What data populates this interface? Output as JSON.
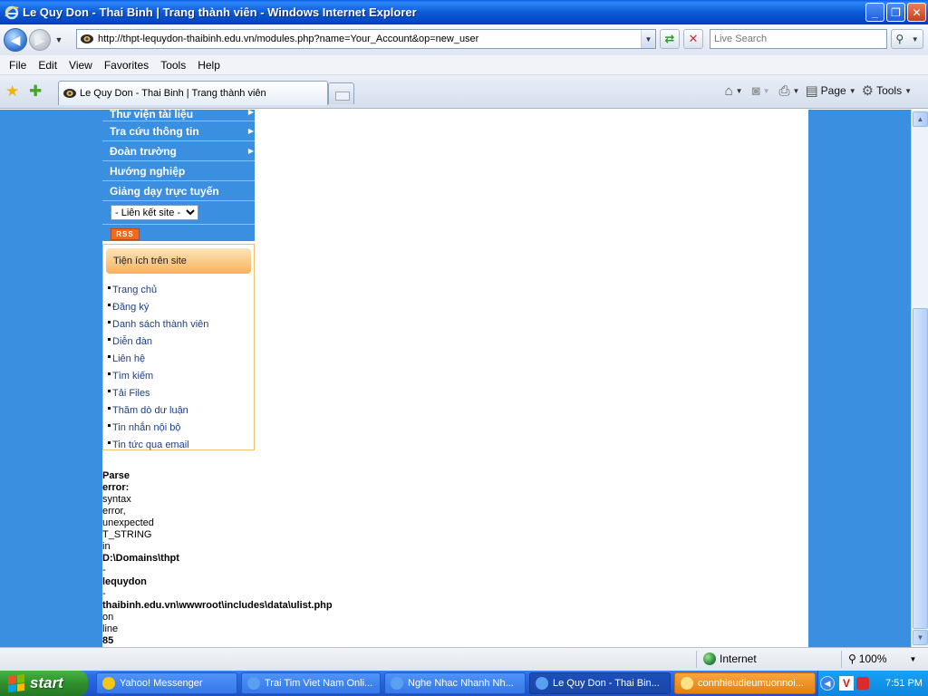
{
  "window": {
    "title": "Le Quy Don - Thai Binh | Trang thành viên - Windows Internet Explorer",
    "btn_min": "_",
    "btn_max": "❐",
    "btn_close": "✕"
  },
  "address": {
    "url": "http://thpt-lequydon-thaibinh.edu.vn/modules.php?name=Your_Account&op=new_user",
    "search_placeholder": "Live Search"
  },
  "menubar": {
    "items": [
      "File",
      "Edit",
      "View",
      "Favorites",
      "Tools",
      "Help"
    ]
  },
  "tabs": {
    "active_label": "Le Quy Don - Thai Binh | Trang thành viên"
  },
  "commandbar": {
    "page": "Page",
    "tools": "Tools"
  },
  "sidebar": {
    "nav": [
      {
        "label": "Thư viện tài liệu",
        "arrow": "▶"
      },
      {
        "label": "Tra cứu thông tin",
        "arrow": "▶"
      },
      {
        "label": "Đoàn trường",
        "arrow": "▶"
      },
      {
        "label": "Hướng nghiệp",
        "arrow": ""
      },
      {
        "label": "Giảng dạy trực tuyến",
        "arrow": ""
      }
    ],
    "link_select": "- Liên kết site -",
    "rss": "RSS"
  },
  "utilities": {
    "heading": "Tiện ích trên site",
    "items": [
      "Trang chủ",
      "Đăng ký",
      "Danh sách thành viên",
      "Diễn đàn",
      "Liên hệ",
      "Tìm kiếm",
      "Tải Files",
      "Thăm dò dư luận",
      "Tin nhắn nội bộ",
      "Tin tức qua email"
    ]
  },
  "error": {
    "lines": [
      {
        "text": "Parse",
        "bold": true
      },
      {
        "text": "error:",
        "bold": true
      },
      {
        "text": "syntax",
        "bold": false
      },
      {
        "text": "error,",
        "bold": false
      },
      {
        "text": "unexpected",
        "bold": false
      },
      {
        "text": "T_STRING",
        "bold": false
      },
      {
        "text": "in",
        "bold": false
      },
      {
        "text": "D:\\Domains\\thpt",
        "bold": true
      },
      {
        "text": "-",
        "bold": false
      },
      {
        "text": "lequydon",
        "bold": true
      },
      {
        "text": "-",
        "bold": false
      },
      {
        "text": "thaibinh.edu.vn\\wwwroot\\includes\\data\\ulist.php",
        "bold": true
      },
      {
        "text": "on",
        "bold": false
      },
      {
        "text": "line",
        "bold": false
      },
      {
        "text": "85",
        "bold": true
      }
    ]
  },
  "statusbar": {
    "zone": "Internet",
    "zoom": "100%"
  },
  "taskbar": {
    "start": "start",
    "items": [
      {
        "label": "Yahoo! Messenger",
        "icon_color": "#f5c518",
        "state": "normal"
      },
      {
        "label": "Trai Tim Viet Nam Onli...",
        "icon_color": "#5aa0f0",
        "state": "normal"
      },
      {
        "label": "Nghe Nhac Nhanh Nh...",
        "icon_color": "#5aa0f0",
        "state": "normal"
      },
      {
        "label": "Le Quy Don - Thai Bin...",
        "icon_color": "#5aa0f0",
        "state": "active"
      },
      {
        "label": "connhieudieumuonnoi...",
        "icon_color": "#ffe082",
        "state": "orange"
      }
    ],
    "clock": "7:51 PM"
  }
}
